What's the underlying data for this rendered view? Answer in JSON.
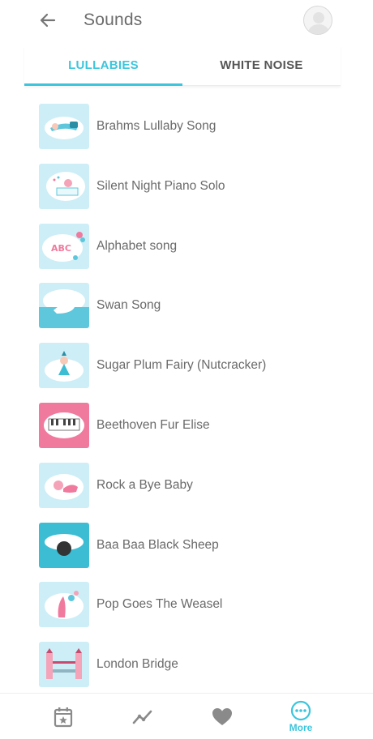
{
  "header": {
    "title": "Sounds",
    "back_icon": "arrow-left-icon",
    "avatar_icon": "user-avatar-icon"
  },
  "tabs": [
    {
      "label": "LULLABIES",
      "active": true
    },
    {
      "label": "WHITE NOISE",
      "active": false
    }
  ],
  "songs": [
    {
      "title": "Brahms Lullaby Song",
      "art": "sleeping-baby"
    },
    {
      "title": "Silent Night Piano Solo",
      "art": "piano-baby"
    },
    {
      "title": "Alphabet song",
      "art": "abc-balloons"
    },
    {
      "title": "Swan Song",
      "art": "swan"
    },
    {
      "title": "Sugar Plum Fairy (Nutcracker)",
      "art": "fairy"
    },
    {
      "title": "Beethoven Fur Elise",
      "art": "pink-piano"
    },
    {
      "title": "Rock a Bye Baby",
      "art": "baby-bed"
    },
    {
      "title": "Baa Baa Black Sheep",
      "art": "sheep"
    },
    {
      "title": "Pop Goes The Weasel",
      "art": "weasel"
    },
    {
      "title": "London Bridge",
      "art": "bridge"
    }
  ],
  "bottom_nav": [
    {
      "icon": "calendar-star-icon",
      "label": "",
      "active": false
    },
    {
      "icon": "trend-chart-icon",
      "label": "",
      "active": false
    },
    {
      "icon": "heart-icon",
      "label": "",
      "active": false
    },
    {
      "icon": "more-dots-icon",
      "label": "More",
      "active": true
    }
  ],
  "colors": {
    "accent": "#3cc5dc",
    "thumb_light": "#cdeef6",
    "thumb_pink": "#f07a9e",
    "thumb_teal": "#3cbdd4"
  }
}
